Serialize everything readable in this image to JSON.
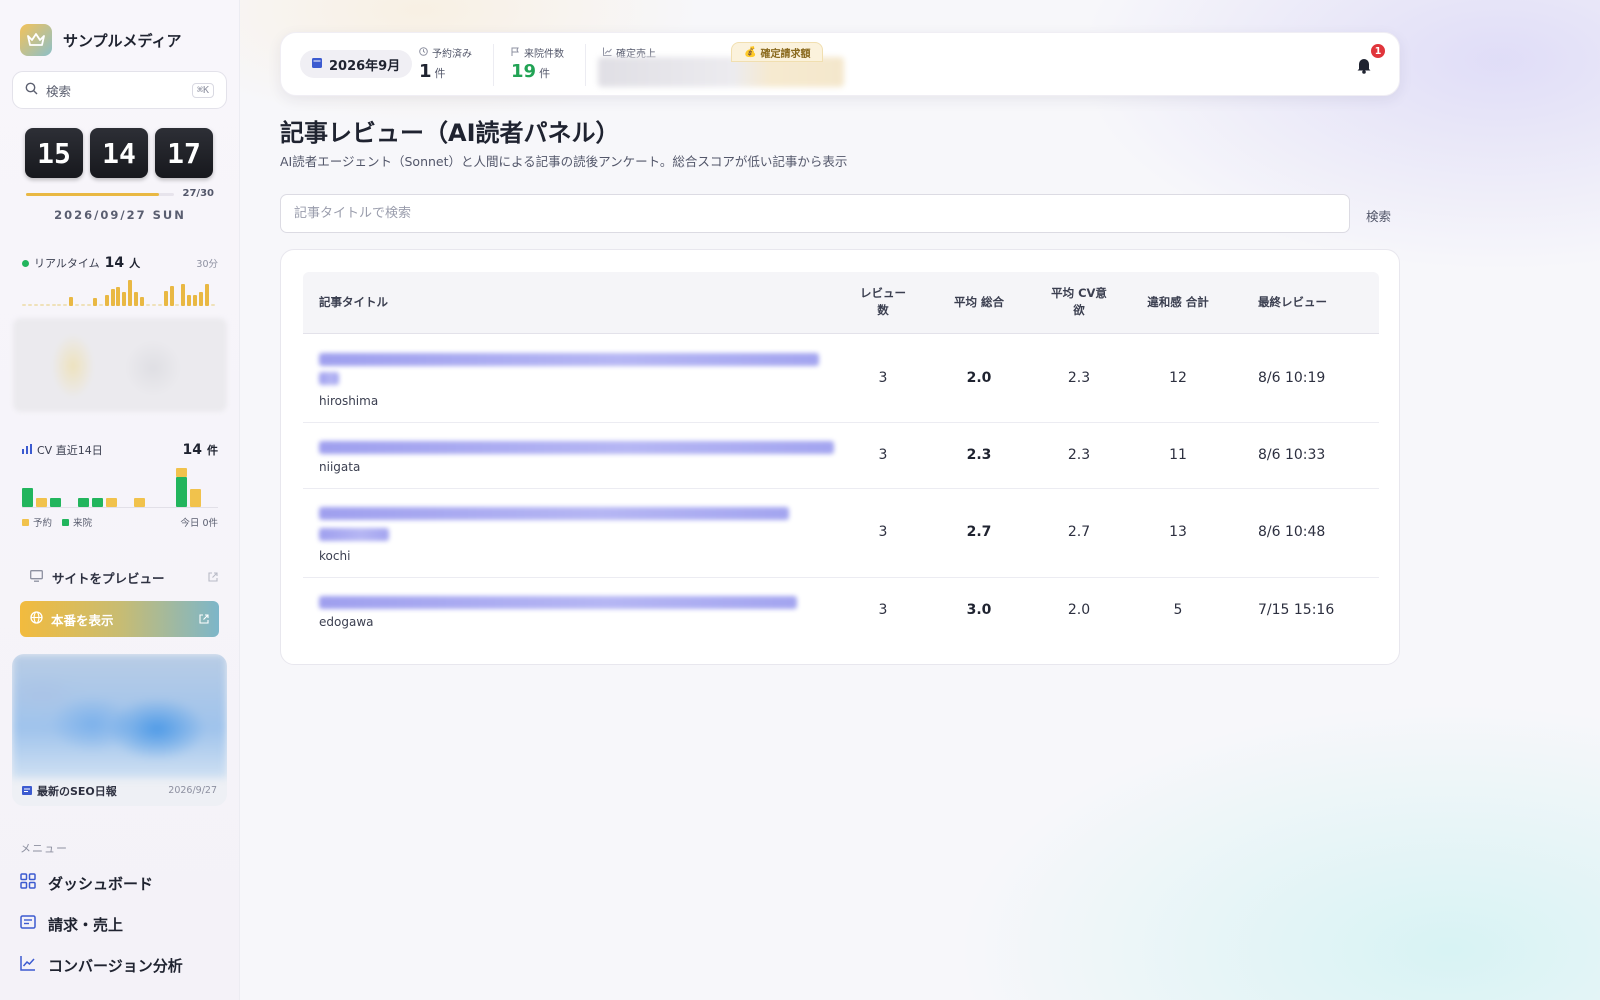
{
  "brand": {
    "name": "サンプルメディア",
    "logo_icon": "crown-icon"
  },
  "search": {
    "label": "検索",
    "shortcut": "⌘K"
  },
  "clock": {
    "hours": "15",
    "minutes": "14",
    "seconds": "17"
  },
  "month_progress": {
    "count": "27/30",
    "fraction": 0.9
  },
  "date_line": "2026/09/27 SUN",
  "realtime": {
    "label": "リアルタイム",
    "value": "14",
    "unit": "人",
    "span": "30分",
    "bars": [
      0.05,
      0.05,
      0.05,
      0.05,
      0.05,
      0.05,
      0.05,
      0.05,
      0.3,
      0.05,
      0.05,
      0.05,
      0.25,
      0.05,
      0.35,
      0.55,
      0.6,
      0.45,
      0.85,
      0.45,
      0.3,
      0.05,
      0.05,
      0.05,
      0.5,
      0.65,
      0.05,
      0.7,
      0.35,
      0.35,
      0.45,
      0.7,
      0.05
    ]
  },
  "cv": {
    "label": "CV 直近14日",
    "value": "14",
    "unit": "件",
    "legend_booking": "予約",
    "legend_visit": "来院",
    "today": "今日 0件",
    "bars": [
      {
        "booking": 0,
        "visit": 0.45
      },
      {
        "booking": 0.2,
        "visit": 0
      },
      {
        "booking": 0,
        "visit": 0.22
      },
      {
        "booking": 0,
        "visit": 0
      },
      {
        "booking": 0,
        "visit": 0.2
      },
      {
        "booking": 0,
        "visit": 0.2
      },
      {
        "booking": 0.2,
        "visit": 0
      },
      {
        "booking": 0,
        "visit": 0
      },
      {
        "booking": 0.2,
        "visit": 0
      },
      {
        "booking": 0,
        "visit": 0
      },
      {
        "booking": 0,
        "visit": 0
      },
      {
        "booking": 0.2,
        "visit": 0.7
      },
      {
        "booking": 0.42,
        "visit": 0
      },
      {
        "booking": 0,
        "visit": 0
      }
    ]
  },
  "preview": {
    "label": "サイトをプレビュー"
  },
  "production": {
    "label": "本番を表示"
  },
  "seo_card": {
    "label": "最新のSEO日報",
    "date": "2026/9/27"
  },
  "menu": {
    "label": "メニュー",
    "items": [
      {
        "label": "ダッシュボード",
        "icon": "grid-icon"
      },
      {
        "label": "請求・売上",
        "icon": "invoice-icon"
      },
      {
        "label": "コンバージョン分析",
        "icon": "chart-line-icon"
      }
    ]
  },
  "topbar": {
    "month": "2026年9月",
    "booked_label": "予約済み",
    "booked_value": "1",
    "booked_unit": "件",
    "visits_label": "来院件数",
    "visits_value": "19",
    "visits_unit": "件",
    "sales_label": "確定売上",
    "invoice_label": "確定請求額",
    "notification_count": "1"
  },
  "colors": {
    "accent_yellow": "#e9b843",
    "accent_green": "#22b55d",
    "brand_blue": "#3c5bd0",
    "badge_red": "#e0353b"
  },
  "page": {
    "title": "記事レビュー（AI読者パネル）",
    "subtitle": "AI読者エージェント（Sonnet）と人間による記事の読後アンケート。総合スコアが低い記事から表示"
  },
  "filter": {
    "placeholder": "記事タイトルで検索",
    "button": "検索"
  },
  "table": {
    "headers": {
      "title": "記事タイトル",
      "reviews_1": "レビュー",
      "reviews_2": "数",
      "avg_total": "平均 総合",
      "avg_cv_1": "平均 CV意",
      "avg_cv_2": "欲",
      "discomfort": "違和感 合計",
      "last_review": "最終レビュー"
    },
    "rows": [
      {
        "slug": "hiroshima",
        "reviews": "3",
        "avg_total": "2.0",
        "avg_cv": "2.3",
        "discomfort": "12",
        "last_review": "8/6 10:19"
      },
      {
        "slug": "niigata",
        "reviews": "3",
        "avg_total": "2.3",
        "avg_cv": "2.3",
        "discomfort": "11",
        "last_review": "8/6 10:33"
      },
      {
        "slug": "kochi",
        "reviews": "3",
        "avg_total": "2.7",
        "avg_cv": "2.7",
        "discomfort": "13",
        "last_review": "8/6 10:48"
      },
      {
        "slug": "edogawa",
        "reviews": "3",
        "avg_total": "3.0",
        "avg_cv": "2.0",
        "discomfort": "5",
        "last_review": "7/15 15:16"
      }
    ]
  }
}
